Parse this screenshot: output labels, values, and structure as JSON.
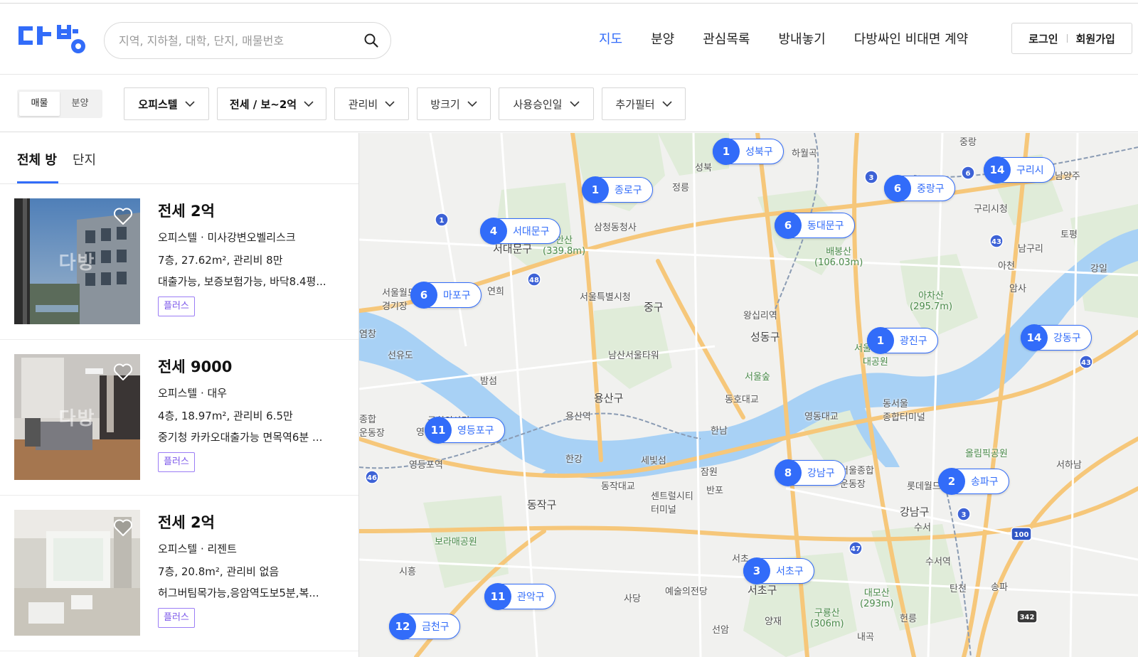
{
  "header": {
    "logo_text": "다방",
    "search": {
      "placeholder": "지역, 지하철, 대학, 단지, 매물번호"
    },
    "nav": [
      {
        "label": "지도",
        "active": true
      },
      {
        "label": "분양",
        "active": false
      },
      {
        "label": "관심목록",
        "active": false
      },
      {
        "label": "방내놓기",
        "active": false
      },
      {
        "label": "다방싸인 비대면 계약",
        "active": false
      }
    ],
    "login_label": "로그인",
    "signup_label": "회원가입"
  },
  "filters": {
    "segment": [
      {
        "label": "매물",
        "selected": true
      },
      {
        "label": "분양",
        "selected": false
      }
    ],
    "buttons": [
      {
        "label": "오피스텔",
        "bold": true
      },
      {
        "label": "전세 / 보~2억",
        "bold": true
      },
      {
        "label": "관리비",
        "bold": false
      },
      {
        "label": "방크기",
        "bold": false
      },
      {
        "label": "사용승인일",
        "bold": false
      },
      {
        "label": "추가필터",
        "bold": false
      }
    ]
  },
  "list": {
    "tabs": [
      {
        "label": "전체 방",
        "active": true
      },
      {
        "label": "단지",
        "active": false
      }
    ],
    "watermark": "다방",
    "items": [
      {
        "price": "전세 2억",
        "type_name": "오피스텔 · 미사강변오벨리스크",
        "details": "7층, 27.62m², 관리비 8만",
        "description": "대출가능, 보증보험가능, 바닥8.4평...",
        "badge": "플러스"
      },
      {
        "price": "전세 9000",
        "type_name": "오피스텔 · 대우",
        "details": "4층, 18.97m², 관리비 6.5만",
        "description": "중기청 카카오대출가능 면목역6분 ...",
        "badge": "플러스"
      },
      {
        "price": "전세 2억",
        "type_name": "오피스텔 · 리젠트",
        "details": "7층, 20.8m², 관리비 없음",
        "description": "허그버팀목가능,응암역도보5분,복...",
        "badge": "플러스"
      }
    ]
  },
  "map": {
    "clusters": [
      {
        "count": "1",
        "name": "성북구"
      },
      {
        "count": "1",
        "name": "종로구"
      },
      {
        "count": "4",
        "name": "서대문구"
      },
      {
        "count": "6",
        "name": "동대문구"
      },
      {
        "count": "6",
        "name": "중랑구"
      },
      {
        "count": "14",
        "name": "구리시"
      },
      {
        "count": "6",
        "name": "마포구"
      },
      {
        "count": "1",
        "name": "광진구"
      },
      {
        "count": "14",
        "name": "강동구"
      },
      {
        "count": "11",
        "name": "영등포구"
      },
      {
        "count": "8",
        "name": "강남구"
      },
      {
        "count": "2",
        "name": "송파구"
      },
      {
        "count": "3",
        "name": "서초구"
      },
      {
        "count": "11",
        "name": "관악구"
      },
      {
        "count": "12",
        "name": "금천구"
      }
    ],
    "labels": [
      {
        "text": "하월곡"
      },
      {
        "text": "중랑"
      },
      {
        "text": "남양주"
      },
      {
        "text": "정릉"
      },
      {
        "text": "삼청동청사"
      },
      {
        "text": "구리시청"
      },
      {
        "text": "토평"
      },
      {
        "text": "남구리"
      },
      {
        "text": "아천"
      },
      {
        "text": "강일"
      },
      {
        "text": "암사"
      },
      {
        "text": "연희"
      },
      {
        "text": "서울특별시청"
      },
      {
        "text": "중구"
      },
      {
        "text": "왕십리역"
      },
      {
        "text": "성동구"
      },
      {
        "text": "배봉산\n(106.03m)"
      },
      {
        "text": "아차산\n(295.7m)"
      },
      {
        "text": "서울월드컵\n경기장"
      },
      {
        "text": "염창"
      },
      {
        "text": "선유도"
      },
      {
        "text": "남산서울타워"
      },
      {
        "text": "밤섬"
      },
      {
        "text": "용산구"
      },
      {
        "text": "용산역"
      },
      {
        "text": "서울숲"
      },
      {
        "text": "동호대교"
      },
      {
        "text": "영동대교"
      },
      {
        "text": "서울어린이\n대공원"
      },
      {
        "text": "동서울\n종합터미널"
      },
      {
        "text": "국회의사당"
      },
      {
        "text": "영등포역"
      },
      {
        "text": "한강"
      },
      {
        "text": "세빛섬"
      },
      {
        "text": "한남"
      },
      {
        "text": "잠원"
      },
      {
        "text": "반포"
      },
      {
        "text": "동작대교"
      },
      {
        "text": "센트럴시티\n터미널"
      },
      {
        "text": "동작구"
      },
      {
        "text": "강남구"
      },
      {
        "text": "올림픽공원"
      },
      {
        "text": "롯데월드"
      },
      {
        "text": "서하남"
      },
      {
        "text": "수서"
      },
      {
        "text": "수서역"
      },
      {
        "text": "보라매공원"
      },
      {
        "text": "시흥"
      },
      {
        "text": "서초"
      },
      {
        "text": "예술의전당"
      },
      {
        "text": "서초구"
      },
      {
        "text": "사당"
      },
      {
        "text": "양재"
      },
      {
        "text": "선암"
      },
      {
        "text": "구룡산\n(306m)"
      },
      {
        "text": "대모산\n(293m)"
      },
      {
        "text": "헌릉"
      },
      {
        "text": "내곡"
      },
      {
        "text": "탄천"
      },
      {
        "text": "송파"
      },
      {
        "text": "안산\n(339.8m)"
      },
      {
        "text": "서대문구"
      },
      {
        "text": "마포구"
      },
      {
        "text": "서울종합\n운동장"
      },
      {
        "text": "성북"
      },
      {
        "text": "영등"
      },
      {
        "text": "종합\n운동장"
      }
    ],
    "shields": [
      {
        "text": "1"
      },
      {
        "text": "48"
      },
      {
        "text": "3"
      },
      {
        "text": "6"
      },
      {
        "text": "43"
      },
      {
        "text": "43"
      },
      {
        "text": "46"
      },
      {
        "text": "3"
      },
      {
        "text": "47"
      },
      {
        "text": "100"
      },
      {
        "text": "342"
      }
    ]
  }
}
